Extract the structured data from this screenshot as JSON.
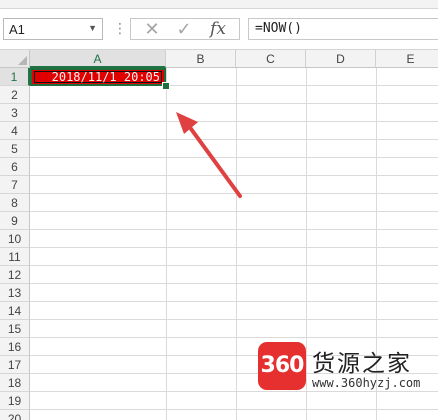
{
  "formula_bar": {
    "name_box": "A1",
    "formula": "=NOW()",
    "fx_label": "fx",
    "cancel_glyph": "✕",
    "enter_glyph": "✓"
  },
  "columns": [
    "A",
    "B",
    "C",
    "D",
    "E"
  ],
  "rows": [
    "1",
    "2",
    "3",
    "4",
    "5",
    "6",
    "7",
    "8",
    "9",
    "10",
    "11",
    "12",
    "13",
    "14",
    "15",
    "16",
    "17",
    "18",
    "19",
    "20"
  ],
  "cells": {
    "A1": "2018/11/1 20:05"
  },
  "colors": {
    "cell_fill": "#e00000",
    "selection": "#1e6e3e",
    "arrow": "#e04040"
  },
  "watermark": {
    "logo": "360",
    "title": "货源之家",
    "url": "www.360hyzj.com"
  }
}
